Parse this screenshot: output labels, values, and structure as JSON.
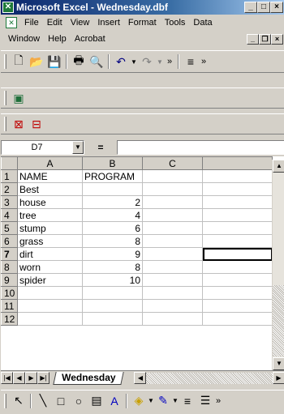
{
  "window": {
    "title": "Microsoft Excel - Wednesday.dbf",
    "min": "_",
    "max": "□",
    "close": "×"
  },
  "menu": {
    "row1": [
      "File",
      "Edit",
      "View",
      "Insert",
      "Format",
      "Tools",
      "Data"
    ],
    "row2": [
      "Window",
      "Help",
      "Acrobat"
    ]
  },
  "formula": {
    "cell": "D7",
    "eq": "=",
    "value": ""
  },
  "sheet": {
    "columns": [
      "A",
      "B",
      "C"
    ],
    "rows": [
      {
        "n": "1",
        "a": "NAME",
        "b": "PROGRAM"
      },
      {
        "n": "2",
        "a": "Best",
        "b": ""
      },
      {
        "n": "3",
        "a": "house",
        "b": "2"
      },
      {
        "n": "4",
        "a": "tree",
        "b": "4"
      },
      {
        "n": "5",
        "a": "stump",
        "b": "6"
      },
      {
        "n": "6",
        "a": "grass",
        "b": "8"
      },
      {
        "n": "7",
        "a": "dirt",
        "b": "9"
      },
      {
        "n": "8",
        "a": "worn",
        "b": "8"
      },
      {
        "n": "9",
        "a": "spider",
        "b": "10"
      },
      {
        "n": "10",
        "a": "",
        "b": ""
      },
      {
        "n": "11",
        "a": "",
        "b": ""
      },
      {
        "n": "12",
        "a": "",
        "b": ""
      }
    ]
  },
  "tabs": {
    "active": "Wednesday"
  },
  "colors": {
    "accent": "#0a246a",
    "chrome": "#d4d0c8"
  }
}
